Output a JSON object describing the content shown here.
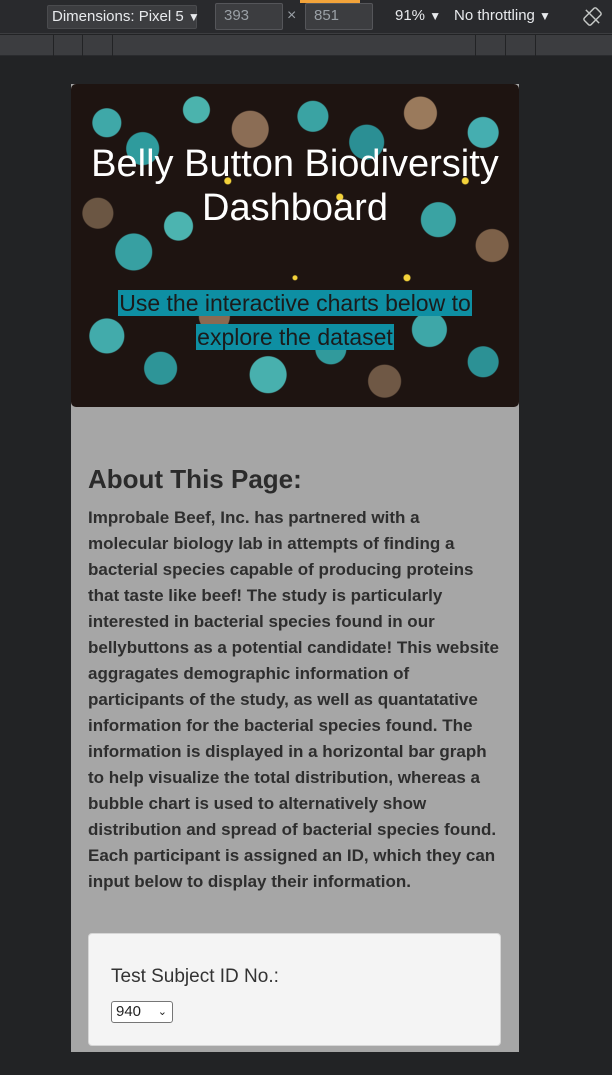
{
  "devtools": {
    "device_label": "Dimensions: Pixel 5",
    "width_value": "393",
    "height_value": "851",
    "times_sign": "×",
    "zoom_label": "91%",
    "throttle_label": "No throttling",
    "dropdown_arrow": "▼",
    "accent_color": "#f2a33a"
  },
  "page": {
    "hero": {
      "title": "Belly Button Biodiversity Dashboard",
      "subtitle": "Use the interactive charts below to explore the dataset",
      "highlight_color": "#0e8fa3"
    },
    "about": {
      "heading": "About This Page:",
      "body": "Improbale Beef, Inc. has partnered with a molecular biology lab in attempts of finding a bacterial species capable of producing proteins that taste like beef! The study is particularly interested in bacterial species found in our bellybuttons as a potential candidate! This website aggragates demographic information of participants of the study, as well as quantatative information for the bacterial species found. The information is displayed in a horizontal bar graph to help visualize the total distribution, whereas a bubble chart is used to alternatively show distribution and spread of bacterial species found. Each participant is assigned an ID, which they can input below to display their information."
    },
    "selector": {
      "label": "Test Subject ID No.:",
      "selected_value": "940",
      "chevron": "⌄"
    }
  }
}
